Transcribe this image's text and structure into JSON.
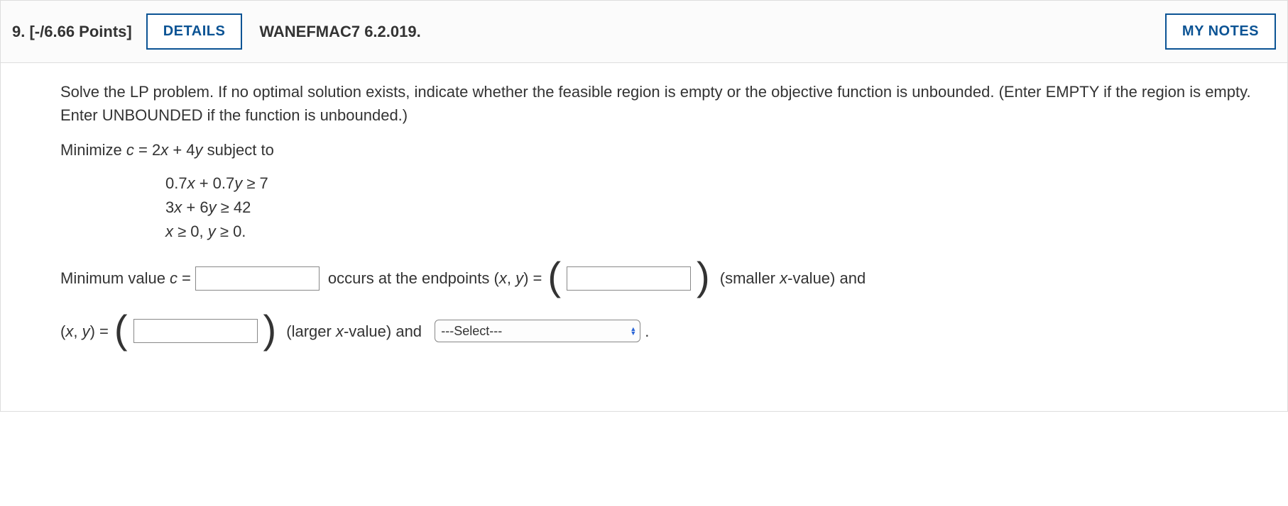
{
  "header": {
    "qnum_prefix": "9.",
    "points": "[-/6.66 Points]",
    "details_label": "DETAILS",
    "problem_code": "WANEFMAC7 6.2.019.",
    "mynotes_label": "MY NOTES"
  },
  "instructions": "Solve the LP problem. If no optimal solution exists, indicate whether the feasible region is empty or the objective function is unbounded. (Enter EMPTY if the region is empty. Enter UNBOUNDED if the function is unbounded.)",
  "objective": {
    "prefix": "Minimize ",
    "expr": "c = 2x + 4y",
    "suffix": " subject to"
  },
  "constraints": [
    "0.7x + 0.7y ≥ 7",
    "3x + 6y ≥ 42",
    "x ≥ 0, y ≥ 0."
  ],
  "answers": {
    "min_label_pre": "Minimum value ",
    "min_var": "c",
    "eq": " = ",
    "occurs": " occurs at the endpoints (",
    "xy1": "x, y",
    "paren_close_eq": ") = ",
    "smaller": " (smaller ",
    "xval": "x",
    "value_and": "-value) and",
    "xy2_open": "(",
    "xy2": "x, y",
    "xy2_close_eq": ") = ",
    "larger": " (larger ",
    "select_placeholder": "---Select---",
    "period": " ."
  }
}
